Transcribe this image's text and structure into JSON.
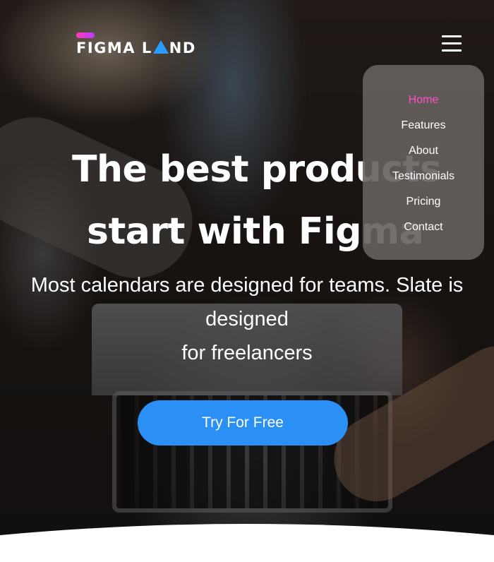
{
  "brand": {
    "name_part1": "FIGMA L",
    "name_part2": "ND",
    "bar_gradient": [
      "#ff3fb4",
      "#b43cff"
    ],
    "triangle_color": "#2a9bff"
  },
  "nav": {
    "toggle_icon": "hamburger-icon",
    "items": [
      {
        "label": "Home",
        "active": true
      },
      {
        "label": "Features",
        "active": false
      },
      {
        "label": "About",
        "active": false
      },
      {
        "label": "Testimonials",
        "active": false
      },
      {
        "label": "Pricing",
        "active": false
      },
      {
        "label": "Contact",
        "active": false
      }
    ],
    "active_color": "#ff4fc2"
  },
  "hero": {
    "headline_line1": "The best products",
    "headline_line2": "start with Figma",
    "subtitle_line1": "Most calendars are designed for teams. Slate is",
    "subtitle_line2": "designed",
    "subtitle_line3": "for freelancers",
    "cta_label": "Try For Free",
    "cta_color": "#2a90f5"
  }
}
